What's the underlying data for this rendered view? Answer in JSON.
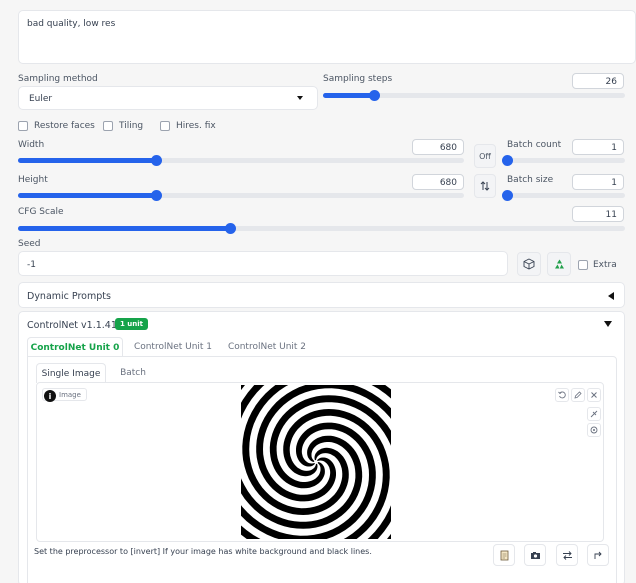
{
  "prompt": {
    "negative_text": "bad quality, low res"
  },
  "sampling": {
    "method_label": "Sampling method",
    "method_value": "Euler",
    "steps_label": "Sampling steps",
    "steps_value": "26",
    "steps_fraction": 0.17
  },
  "options": {
    "restore_faces": "Restore faces",
    "tiling": "Tiling",
    "hires_fix": "Hires. fix"
  },
  "size": {
    "width_label": "Width",
    "width_value": "680",
    "width_fraction": 0.31,
    "height_label": "Height",
    "height_value": "680",
    "height_fraction": 0.31,
    "swap_label": "Off"
  },
  "batch": {
    "count_label": "Batch count",
    "count_value": "1",
    "count_fraction": 0.0,
    "size_label": "Batch size",
    "size_value": "1",
    "size_fraction": 0.0
  },
  "cfg": {
    "label": "CFG Scale",
    "value": "11",
    "fraction": 0.35
  },
  "seed": {
    "label": "Seed",
    "value": "-1",
    "extra_label": "Extra"
  },
  "dynamic_prompts": {
    "title": "Dynamic Prompts"
  },
  "controlnet": {
    "title": "ControlNet v1.1.410",
    "badge": "1 unit",
    "tabs": [
      "ControlNet Unit 0",
      "ControlNet Unit 1",
      "ControlNet Unit 2"
    ],
    "image_tabs": [
      "Single Image",
      "Batch"
    ],
    "image_label": "Image",
    "hint": "Set the preprocessor to [invert] If your image has white background and black lines."
  },
  "colors": {
    "accent": "#2563eb",
    "active_tab": "#16a34a",
    "badge_bg": "#16a34a"
  }
}
